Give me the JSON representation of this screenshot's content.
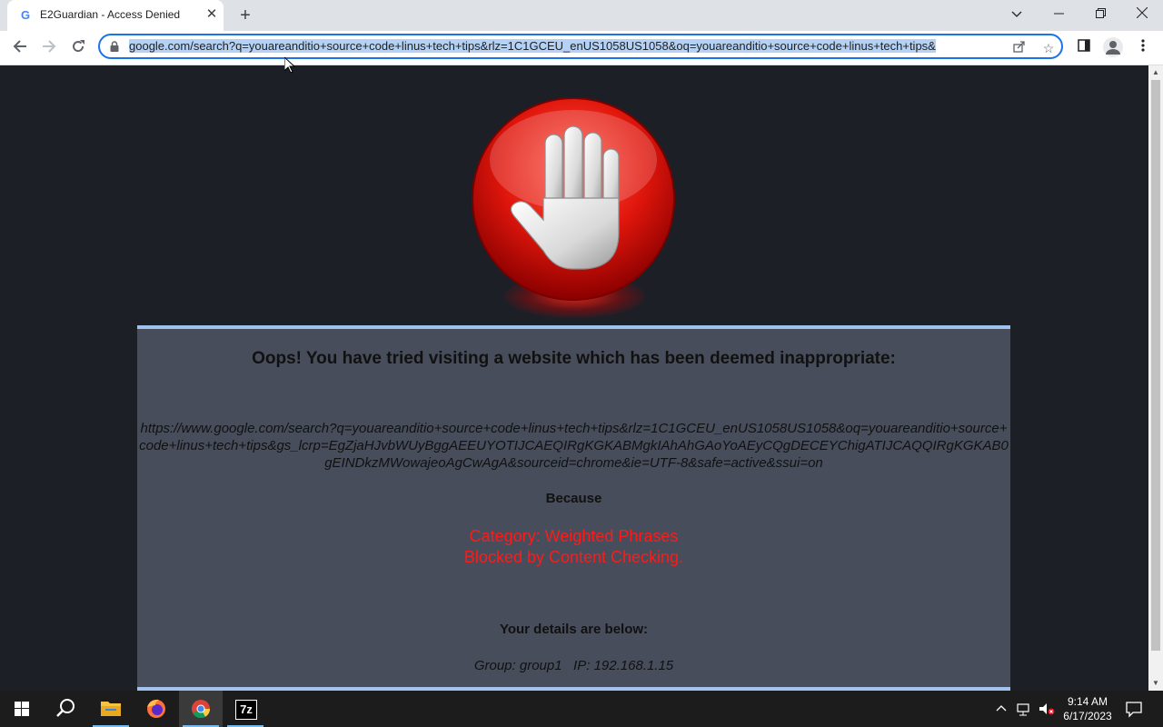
{
  "browser": {
    "tab": {
      "title": "E2Guardian - Access Denied",
      "favicon": "G"
    },
    "address_bar": {
      "url": "google.com/search?q=youareanditio+source+code+linus+tech+tips&rlz=1C1GCEU_enUS1058US1058&oq=youareanditio+source+code+linus+tech+tips&"
    },
    "icons": [
      "back-icon",
      "forward-icon",
      "reload-icon",
      "lock-icon",
      "share-icon",
      "star-icon",
      "side-panel-icon",
      "profile-icon",
      "menu-icon",
      "new-tab-icon",
      "close-icon",
      "minimize-icon",
      "restore-icon",
      "tab-search-icon"
    ]
  },
  "page": {
    "heading": "Oops! You have tried visiting a website which has been deemed inappropriate:",
    "blocked_url": "https://www.google.com/search?q=youareanditio+source+code+linus+tech+tips&rlz=1C1GCEU_enUS1058US1058&oq=youareanditio+source+code+linus+tech+tips&gs_lcrp=EgZjaHJvbWUyBggAEEUYOTIJCAEQIRgKGKABMgkIAhAhGAoYoAEyCQgDECEYChigATIJCAQQIRgKGKAB0gEINDkzMWowajeoAgCwAgA&sourceid=chrome&ie=UTF-8&safe=active&ssui=on",
    "because": "Because",
    "category": "Category: Weighted Phrases",
    "reason": "Blocked by Content Checking.",
    "details_heading": "Your details are below:",
    "details": "Group: group1   IP: 192.168.1.15",
    "colors": {
      "panel_bg": "#474d5b",
      "page_bg": "#1d1f26",
      "reason_red": "#ff1a1a",
      "panel_border": "#9fc3ee"
    }
  },
  "taskbar": {
    "apps": [
      "windows-start-icon",
      "search-icon",
      "file-explorer-icon",
      "firefox-icon",
      "chrome-icon",
      "7zip-icon"
    ],
    "seven_zip_label": "7z",
    "time": "9:14 AM",
    "date": "6/17/2023"
  }
}
